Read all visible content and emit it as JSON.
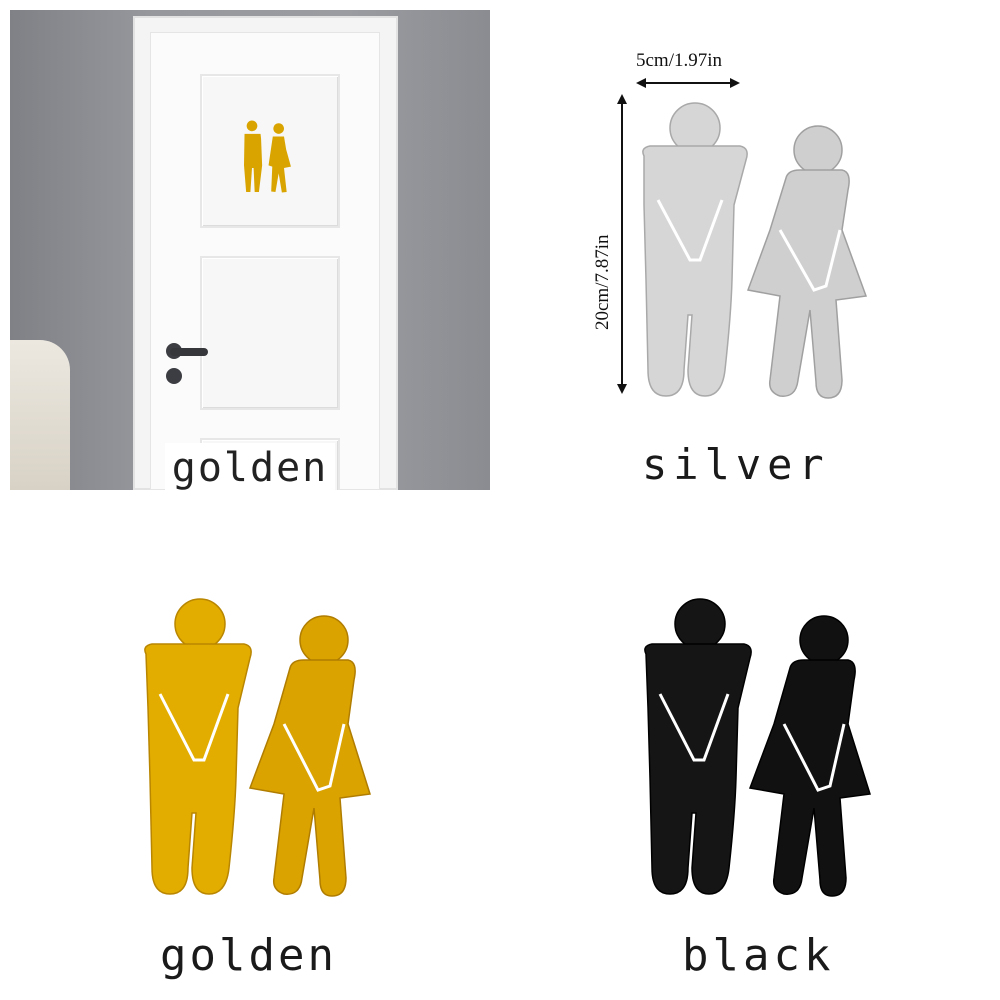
{
  "panels": {
    "door_photo": {
      "caption": "golden"
    },
    "silver": {
      "caption": "silver",
      "fill": "#d9d9d9",
      "shade": "#9c9c9c"
    },
    "golden": {
      "caption": "golden",
      "fill": "#e0a800",
      "shade": "#b98200"
    },
    "black": {
      "caption": "black",
      "fill": "#141414",
      "shade": "#3a3a3a"
    }
  },
  "dimensions": {
    "width": "5cm/1.97in",
    "height": "20cm/7.87in"
  },
  "colors": {
    "background": "#ffffff",
    "wall": "#8d8f94",
    "door": "#fbfbfb"
  }
}
